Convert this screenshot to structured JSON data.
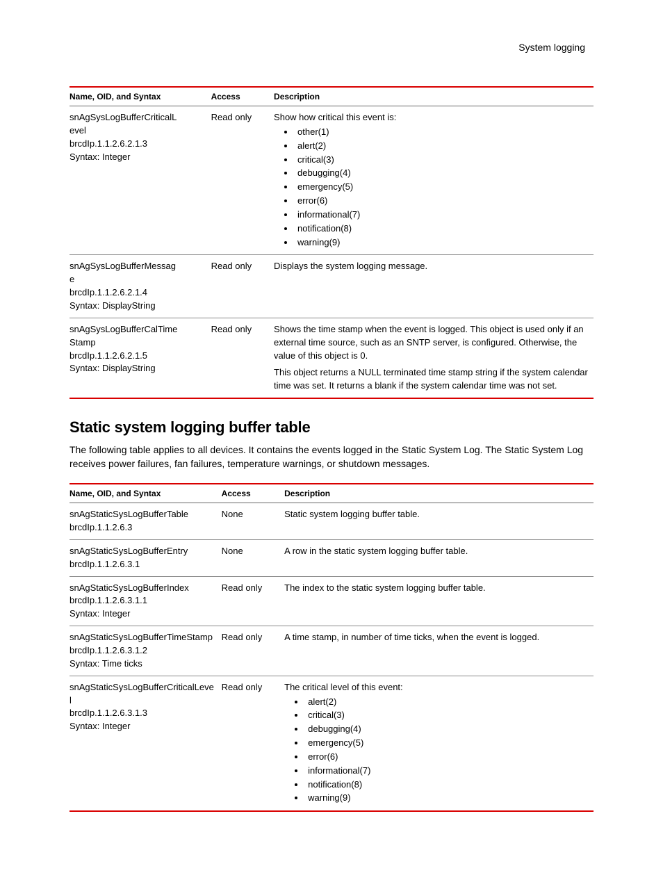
{
  "header": {
    "running_title": "System logging"
  },
  "table1": {
    "headers": {
      "c1": "Name, OID, and Syntax",
      "c2": "Access",
      "c3": "Description"
    },
    "rows": [
      {
        "name_lines": [
          "snAgSysLogBufferCriticalL",
          "evel",
          "brcdIp.1.1.2.6.2.1.3",
          "Syntax: Integer"
        ],
        "access": "Read only",
        "desc_lead": "Show how critical this event is:",
        "bullets": [
          "other(1)",
          "alert(2)",
          "critical(3)",
          "debugging(4)",
          "emergency(5)",
          "error(6)",
          "informational(7)",
          "notification(8)",
          "warning(9)"
        ]
      },
      {
        "name_lines": [
          "snAgSysLogBufferMessag",
          "e",
          "brcdIp.1.1.2.6.2.1.4",
          "Syntax: DisplayString"
        ],
        "access": "Read only",
        "desc_paras": [
          "Displays the system logging message."
        ]
      },
      {
        "name_lines": [
          "snAgSysLogBufferCalTime",
          "Stamp",
          "brcdIp.1.1.2.6.2.1.5",
          "Syntax: DisplayString"
        ],
        "access": "Read only",
        "desc_paras": [
          "Shows the time stamp when the event is logged. This object is used only if an external time source, such as an SNTP server, is configured. Otherwise, the value of this object is 0.",
          "This object returns a NULL terminated time stamp string if the system calendar time was set. It returns a blank if the system calendar time was not set."
        ]
      }
    ]
  },
  "section": {
    "heading": "Static system logging buffer table",
    "para": "The following table applies to all devices. It contains the events logged in the Static System Log. The Static System Log receives power failures, fan failures, temperature warnings, or shutdown messages."
  },
  "table2": {
    "headers": {
      "c1": "Name, OID, and Syntax",
      "c2": "Access",
      "c3": "Description"
    },
    "rows": [
      {
        "name_lines": [
          "snAgStaticSysLogBufferTable",
          "brcdIp.1.1.2.6.3"
        ],
        "access": "None",
        "desc_paras": [
          "Static system logging buffer table."
        ]
      },
      {
        "name_lines": [
          "snAgStaticSysLogBufferEntry",
          "brcdIp.1.1.2.6.3.1"
        ],
        "access": "None",
        "desc_paras": [
          "A row in the static system logging buffer table."
        ]
      },
      {
        "name_lines": [
          "snAgStaticSysLogBufferIndex",
          "brcdIp.1.1.2.6.3.1.1",
          "Syntax: Integer"
        ],
        "access": "Read only",
        "desc_paras": [
          "The index to the static system logging buffer table."
        ]
      },
      {
        "name_lines": [
          "snAgStaticSysLogBufferTimeStamp",
          "brcdIp.1.1.2.6.3.1.2",
          "Syntax: Time ticks"
        ],
        "access": "Read only",
        "desc_paras": [
          "A time stamp, in number of time ticks, when the event is logged."
        ]
      },
      {
        "name_lines": [
          "snAgStaticSysLogBufferCriticalLeve",
          "l",
          "brcdIp.1.1.2.6.3.1.3",
          "Syntax: Integer"
        ],
        "access": "Read only",
        "desc_lead": "The critical level of this event:",
        "bullets": [
          "alert(2)",
          "critical(3)",
          "debugging(4)",
          "emergency(5)",
          "error(6)",
          "informational(7)",
          "notification(8)",
          "warning(9)"
        ]
      }
    ]
  }
}
